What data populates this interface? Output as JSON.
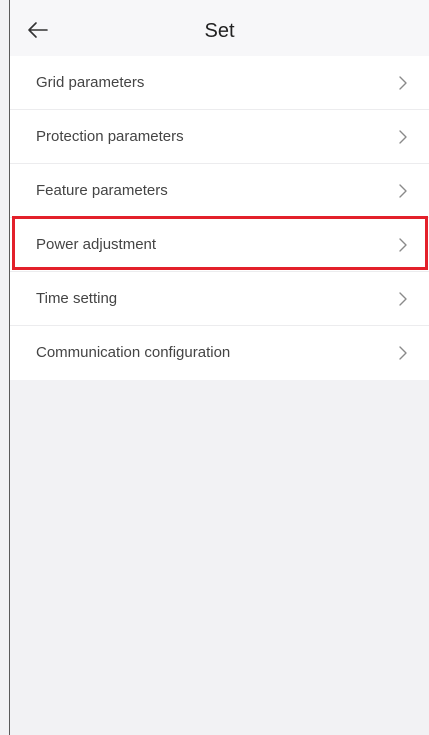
{
  "header": {
    "title": "Set",
    "back_icon": "arrow-left-icon"
  },
  "menu": {
    "items": [
      {
        "label": "Grid parameters",
        "icon": "chevron-right-icon"
      },
      {
        "label": "Protection parameters",
        "icon": "chevron-right-icon"
      },
      {
        "label": "Feature parameters",
        "icon": "chevron-right-icon"
      },
      {
        "label": "Power adjustment",
        "icon": "chevron-right-icon",
        "highlighted": true
      },
      {
        "label": "Time setting",
        "icon": "chevron-right-icon"
      },
      {
        "label": "Communication configuration",
        "icon": "chevron-right-icon"
      }
    ]
  },
  "colors": {
    "highlight": "#e3202a",
    "background": "#f2f2f4",
    "list_background": "#ffffff",
    "text": "#444444"
  }
}
